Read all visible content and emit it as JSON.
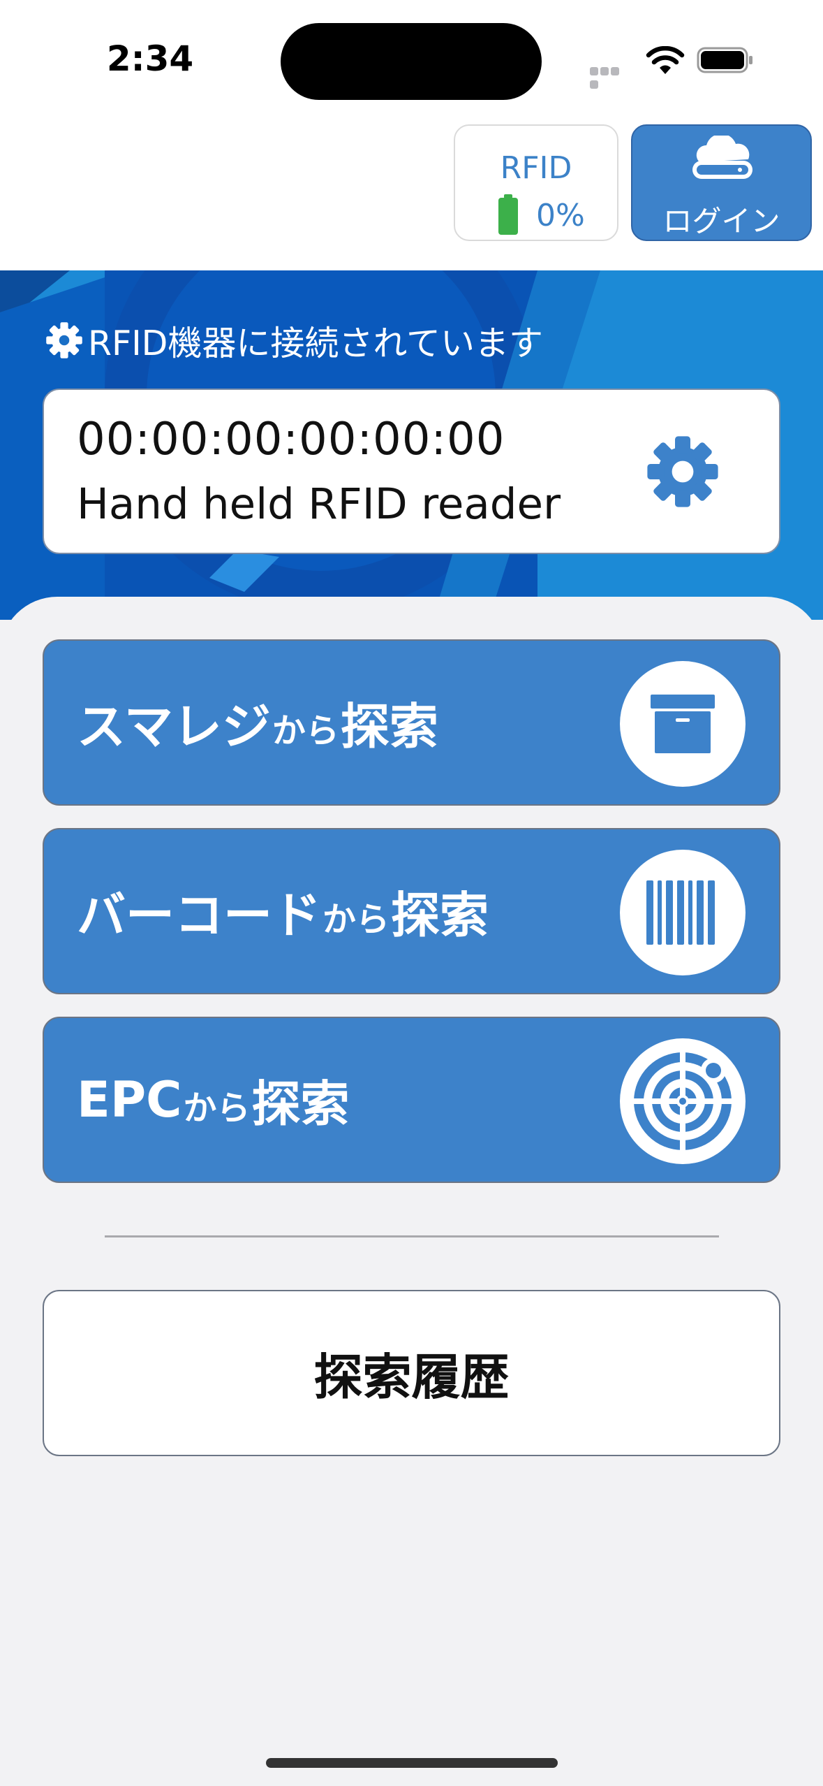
{
  "status_bar": {
    "time": "2:34",
    "icons": [
      "cellular-signal-icon",
      "wifi-icon",
      "battery-icon"
    ]
  },
  "header": {
    "rfid_status": {
      "label": "RFID",
      "battery_percent": "0%",
      "icon": "battery-icon"
    },
    "login_button": {
      "label": "ログイン",
      "icon": "cloud-icon"
    }
  },
  "connection": {
    "status_text": "RFID機器に接続されています",
    "icon": "gear-icon",
    "device": {
      "mac_address": "00:00:00:00:00:00",
      "name": "Hand held RFID reader",
      "settings_icon": "gear-icon"
    }
  },
  "search_buttons": [
    {
      "prefix": "スマレジ",
      "middle": "から",
      "suffix": "探索",
      "icon": "archive-box-icon"
    },
    {
      "prefix": "バーコード",
      "middle": "から",
      "suffix": "探索",
      "icon": "barcode-icon"
    },
    {
      "prefix": "EPC",
      "middle": "から",
      "suffix": "探索",
      "icon": "radar-icon"
    }
  ],
  "history_button": {
    "label": "探索履歴"
  },
  "colors": {
    "accent": "#3d82ca",
    "hero_blue": "#1c8ad6",
    "battery_green": "#3cb04a",
    "background": "#f2f2f4"
  }
}
